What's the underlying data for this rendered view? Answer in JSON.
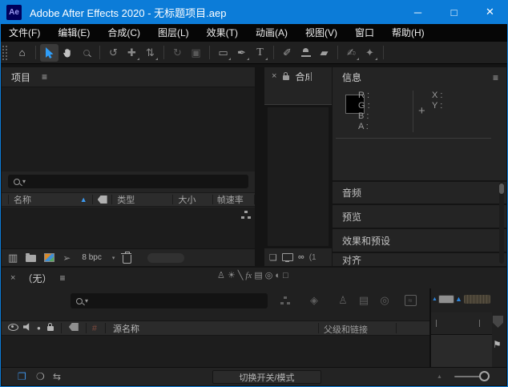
{
  "window": {
    "title": "Adobe After Effects 2020 - 无标题项目.aep",
    "logo": "Ae",
    "accent_color": "#0c7cd8",
    "controls": {
      "minimize": "─",
      "maximize": "□",
      "close": "✕"
    }
  },
  "menu": {
    "items": [
      "文件(F)",
      "编辑(E)",
      "合成(C)",
      "图层(L)",
      "效果(T)",
      "动画(A)",
      "视图(V)",
      "窗口",
      "帮助(H)"
    ]
  },
  "toolbar": {
    "text_tool": "T"
  },
  "project": {
    "tab": "项目",
    "columns": {
      "name": "名称",
      "type": "类型",
      "size": "大小",
      "frame_rate": "帧速率"
    },
    "bpc": "8 bpc"
  },
  "composition": {
    "tab": "合成",
    "zoom_text": "(1"
  },
  "info": {
    "tab": "信息",
    "r": "R :",
    "g": "G :",
    "b": "B :",
    "a": "A :",
    "x": "X :",
    "y": "Y :",
    "crosshair": "+",
    "swatch_color": "#000000"
  },
  "collapsed_panels": {
    "audio": "音频",
    "preview": "预览",
    "effects": "效果和预设",
    "align": "对齐"
  },
  "timeline": {
    "tab": "（无）",
    "hash": "#",
    "source_name": "源名称",
    "parent_link": "父级和链接",
    "toggle_modes": "切换开关/模式",
    "fx": "fx"
  },
  "icons": {
    "menu": "≡",
    "close": "×",
    "caret": "▾",
    "home": "⌂",
    "orbit": "↺",
    "pan": "✚",
    "dolly": "⇅",
    "rotate": "↻",
    "roi": "▣",
    "rect_mask": "▭",
    "pen": "✒",
    "brush": "✐",
    "eraser": "▰",
    "roto": "✍",
    "puppet": "✦",
    "interpret": "▥",
    "quill": "➢",
    "cascade": "❏",
    "vr": "∞",
    "sort": "▲",
    "solo": "●",
    "shy": "♙",
    "collapse": "☀",
    "quality": "╲",
    "frame_blend": "▤",
    "motion_blur": "◎",
    "adjustment": "◐",
    "cube": "□",
    "draft3d": "◈",
    "graph": "≈",
    "layer_pane": "❐",
    "transfer_pane": "❍",
    "inout_pane": "⇆",
    "flag": "⚑",
    "mountain": "▲"
  }
}
